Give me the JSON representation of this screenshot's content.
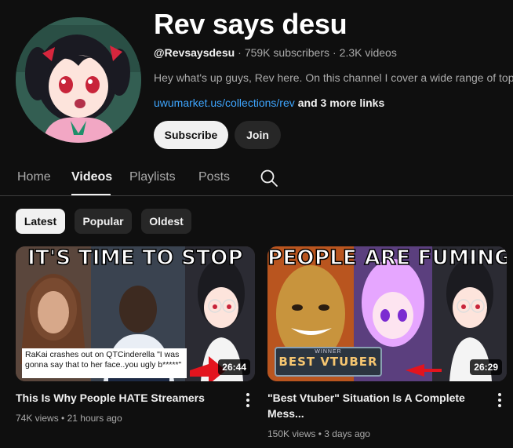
{
  "channel": {
    "name": "Rev says desu",
    "handle": "@Revsaysdesu",
    "separator": "·",
    "subscribers": "759K subscribers",
    "videos": "2.3K videos",
    "description": "Hey what's up guys, Rev here. On this channel I cover a wide range of topics",
    "link": "uwumarket.us/collections/rev",
    "more_links": "and 3 more links"
  },
  "actions": {
    "subscribe_label": "Subscribe",
    "join_label": "Join"
  },
  "tabs": [
    {
      "label": "Home",
      "active": false
    },
    {
      "label": "Videos",
      "active": true
    },
    {
      "label": "Playlists",
      "active": false
    },
    {
      "label": "Posts",
      "active": false
    }
  ],
  "filters": [
    {
      "label": "Latest",
      "selected": true
    },
    {
      "label": "Popular",
      "selected": false
    },
    {
      "label": "Oldest",
      "selected": false
    }
  ],
  "videos": [
    {
      "thumb_text": "IT'S TIME TO STOP",
      "thumb_caption": "RaKai crashes out on QTCinderella \"I was gonna say that to her face..you ugly b*****\"",
      "duration": "26:44",
      "title": "This Is Why People HATE Streamers",
      "views": "74K views",
      "age": "21 hours ago",
      "separator": "•"
    },
    {
      "thumb_text": "PEOPLE ARE FUMING",
      "thumb_badge_label": "WINNER",
      "thumb_badge_text": "BEST VTUBER",
      "duration": "26:29",
      "title": "\"Best Vtuber\" Situation Is A Complete Mess...",
      "views": "150K views",
      "age": "3 days ago",
      "separator": "•"
    }
  ],
  "icons": {
    "search": "search-icon",
    "more": "more-vert-icon"
  },
  "colors": {
    "background": "#0f0f0f",
    "link": "#3ea6ff",
    "chip_selected": "#f1f1f1",
    "chip": "#272727"
  }
}
